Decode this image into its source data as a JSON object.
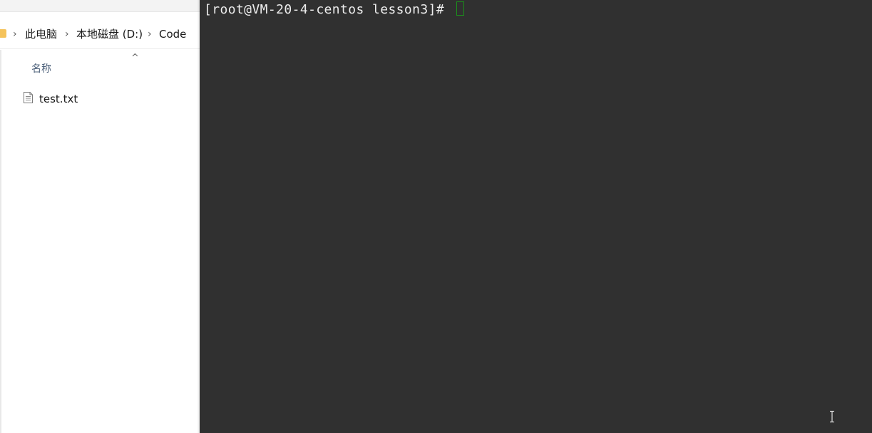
{
  "explorer": {
    "breadcrumb": [
      "此电脑",
      "本地磁盘 (D:)",
      "Code"
    ],
    "column_header": "名称",
    "sort_indicator": "^",
    "files": [
      {
        "name": "test.txt",
        "icon": "text-file-icon"
      }
    ]
  },
  "terminal": {
    "prompt": "[root@VM-20-4-centos lesson3]# ",
    "cursor_color": "#1b8f1b",
    "background": "#303030"
  },
  "colors": {
    "folder": "#f5c35b",
    "header_text": "#4c607a"
  }
}
